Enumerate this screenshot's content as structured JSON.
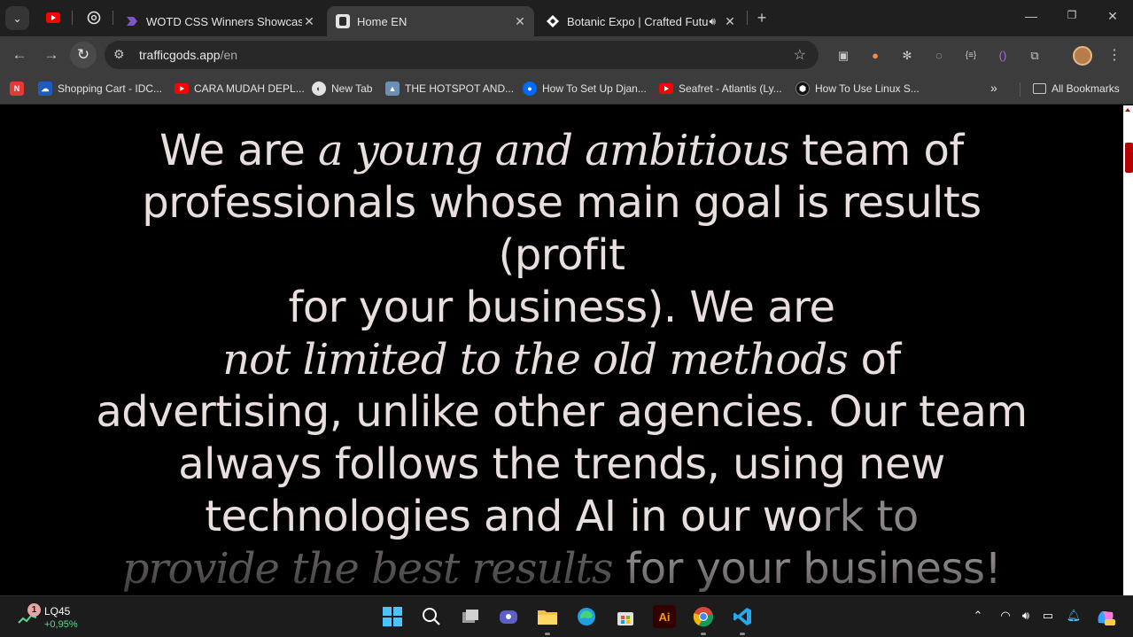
{
  "tabs": {
    "pinned": [
      "youtube-icon",
      "chatgpt-icon"
    ],
    "items": [
      {
        "title": "WOTD CSS Winners Showcase -",
        "active": false,
        "icon": "cssdesign-icon",
        "color": "#7e57c2"
      },
      {
        "title": "Home EN",
        "active": true,
        "icon": "trafficgods-icon",
        "color": "#2b2b2b"
      },
      {
        "title": "Botanic Expo | Crafted Futur",
        "active": false,
        "icon": "botanic-icon",
        "color": "#ffffff"
      }
    ],
    "close_glyph": "✕",
    "new_tab_glyph": "+"
  },
  "toolbar": {
    "url_host": "trafficgods.app",
    "url_path": "/en"
  },
  "bookmarks": {
    "items": [
      {
        "label": "Shopping Cart - IDC...",
        "icon": "idcloudhost-icon",
        "color": "#1e5bbf"
      },
      {
        "label": "CARA MUDAH DEPL...",
        "icon": "youtube-icon",
        "color": "#ff0000"
      },
      {
        "label": "New Tab",
        "icon": "chrome-newtab-icon",
        "color": "#5f6368"
      },
      {
        "label": "THE HOTSPOT AND...",
        "icon": "wolf-icon",
        "color": "#6b8fb5"
      },
      {
        "label": "How To Set Up Djan...",
        "icon": "digitalocean-icon",
        "color": "#0069ff"
      },
      {
        "label": "Seafret - Atlantis (Ly...",
        "icon": "youtube-icon",
        "color": "#ff0000"
      },
      {
        "label": "How To Use Linux S...",
        "icon": "hex-icon",
        "color": "#111111"
      }
    ],
    "overflow_glyph": "»",
    "all_bookmarks": "All Bookmarks"
  },
  "page": {
    "lines": [
      [
        {
          "t": "We are ",
          "s": "sans"
        },
        {
          "t": "a young and ambitious",
          "s": "serif"
        },
        {
          "t": " team of",
          "s": "sans"
        }
      ],
      [
        {
          "t": "professionals whose main goal is results",
          "s": "sans"
        }
      ],
      [
        {
          "t": "(profit",
          "s": "sans"
        }
      ],
      [
        {
          "t": "for your business). We are",
          "s": "sans"
        }
      ],
      [
        {
          "t": "not limited to the old methods",
          "s": "serif"
        },
        {
          "t": " of",
          "s": "sans"
        }
      ],
      [
        {
          "t": "advertising, unlike other agencies. Our team",
          "s": "sans"
        }
      ],
      [
        {
          "t": "always follows the trends, using new",
          "s": "sans"
        }
      ],
      [
        {
          "t": "technologies and AI in our wo",
          "s": "sans"
        },
        {
          "t": "rk to",
          "s": "sans-dim"
        }
      ],
      [
        {
          "t": "provide the best results",
          "s": "serif-dim2"
        },
        {
          "t": " for your business!",
          "s": "sans-dim"
        }
      ]
    ]
  },
  "taskbar": {
    "stock_name": "LQ45",
    "stock_change": "+0,95%",
    "stock_badge": "1",
    "apps": [
      "windows-start-icon",
      "search-icon",
      "task-view-icon",
      "meet-icon",
      "file-explorer-icon",
      "edge-icon",
      "store-icon",
      "illustrator-icon",
      "chrome-icon",
      "vscode-icon"
    ],
    "illustrator_label": "Ai"
  }
}
